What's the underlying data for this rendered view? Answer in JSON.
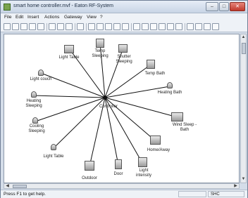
{
  "window": {
    "title": "smart home controller.mvf - Eaton RF-System",
    "buttons": {
      "minimize": "–",
      "maximize": "□",
      "close": "✕"
    }
  },
  "menu": [
    "File",
    "Edit",
    "Insert",
    "Actions",
    "Gateway",
    "View",
    "?"
  ],
  "toolbar_icons": [
    "new-icon",
    "open-icon",
    "save-icon",
    "undo-icon",
    "redo-icon",
    "cut-icon",
    "copy-icon",
    "paste-icon",
    "settings-icon",
    "grid-icon",
    "grid-icon",
    "grid-icon",
    "grid-icon",
    "grid-icon",
    "arrange-icon",
    "arrange-icon",
    "arrange-icon",
    "arrange-icon",
    "arrange-icon",
    "arrange-icon",
    "zoom-in-icon",
    "zoom-out-icon",
    "search-icon",
    "info-icon"
  ],
  "hub": {
    "label": "Controller"
  },
  "nodes": [
    {
      "label": "Light Table",
      "icon": "light-icon"
    },
    {
      "label": "Temp Sleeping",
      "icon": "thermostat-icon"
    },
    {
      "label": "Shutter Sleeping",
      "icon": "shutter-icon"
    },
    {
      "label": "Temp Bath",
      "icon": "thermostat-icon"
    },
    {
      "label": "Light couch",
      "icon": "light-icon"
    },
    {
      "label": "Heating Bath",
      "icon": "heating-icon"
    },
    {
      "label": "Heating Sleeping",
      "icon": "heating-icon"
    },
    {
      "label": "Cooling Sleeping",
      "icon": "cooling-icon"
    },
    {
      "label": "Wind Sleep - Bath",
      "icon": "sensor-icon"
    },
    {
      "label": "Light Table",
      "icon": "light-icon"
    },
    {
      "label": "Home/Away",
      "icon": "switch-icon"
    },
    {
      "label": "Outdoor",
      "icon": "sensor-icon"
    },
    {
      "label": "Door",
      "icon": "door-icon"
    },
    {
      "label": "Light intensity",
      "icon": "sensor-icon"
    }
  ],
  "status": {
    "text": "Press F1 to get help.",
    "pane": "SHC"
  }
}
